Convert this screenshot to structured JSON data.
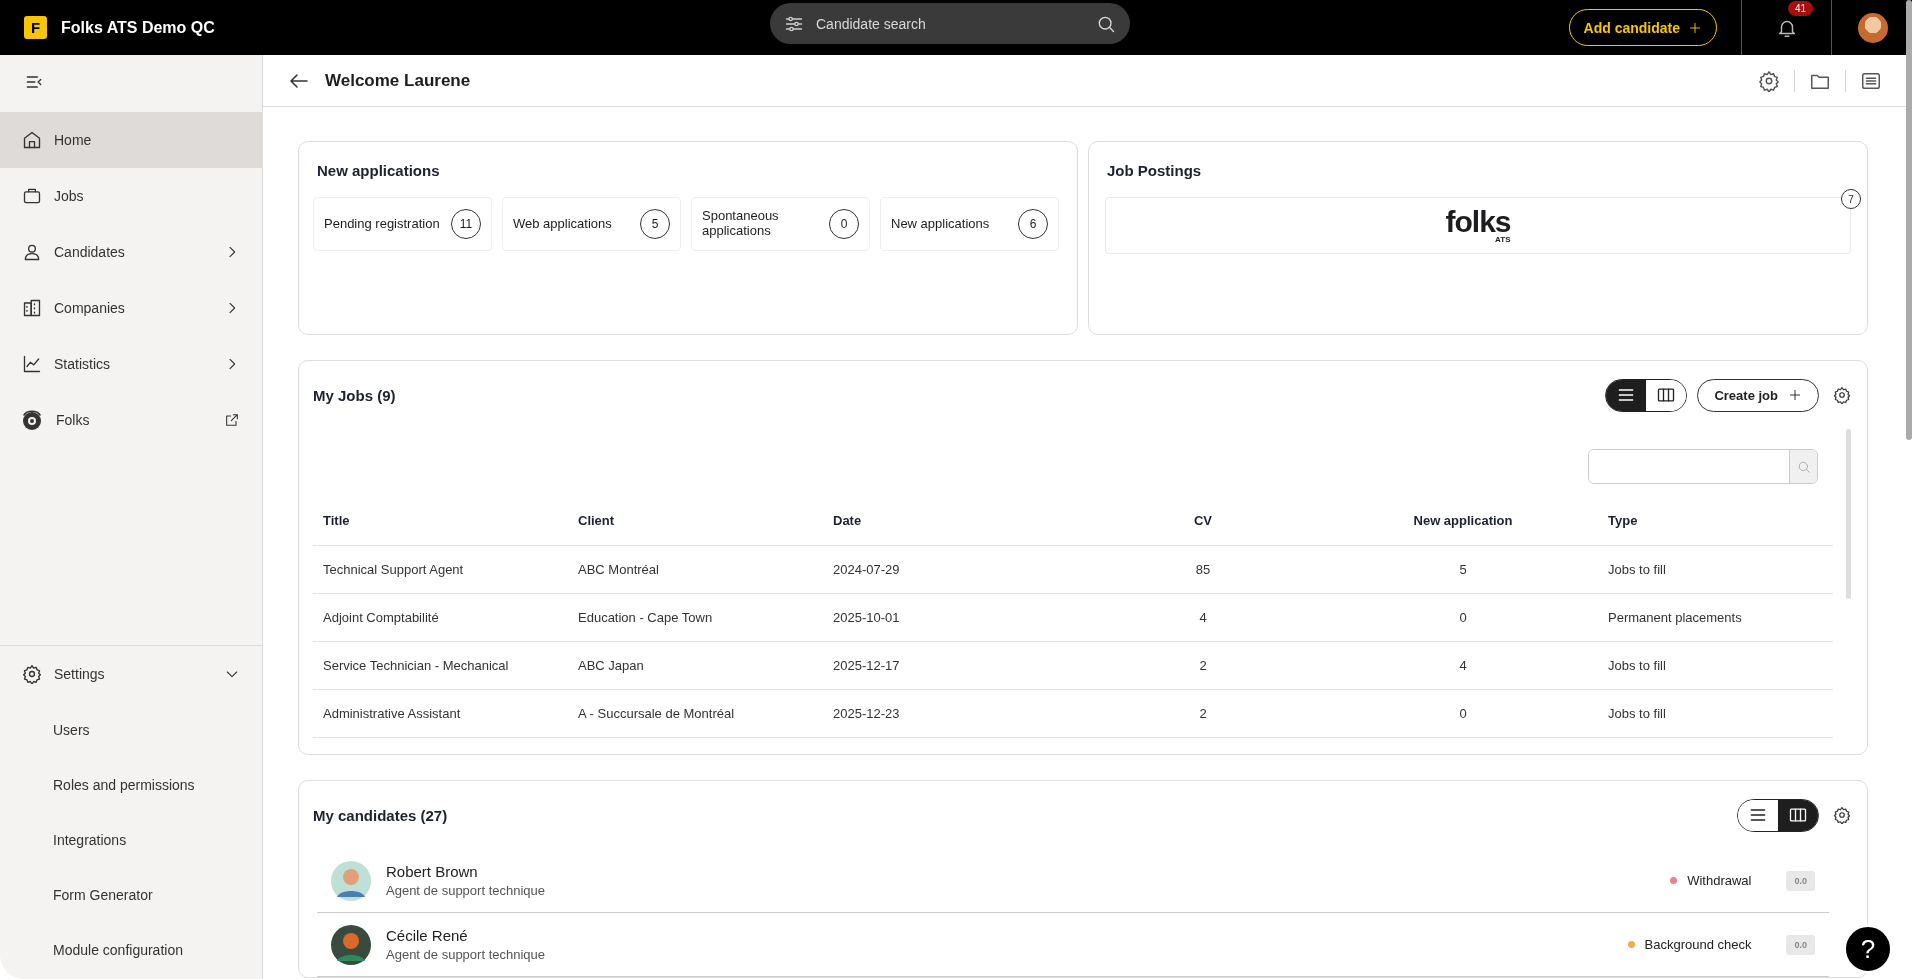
{
  "app": {
    "logo_letter": "F",
    "title": "Folks ATS Demo QC"
  },
  "search": {
    "placeholder": "Candidate search"
  },
  "add_button": {
    "label": "Add candidate"
  },
  "notifications": {
    "count": "41"
  },
  "sidebar": {
    "items": [
      {
        "label": "Home",
        "kind": "page",
        "selected": true
      },
      {
        "label": "Jobs",
        "kind": "page",
        "selected": false
      },
      {
        "label": "Candidates",
        "kind": "menu",
        "selected": false
      },
      {
        "label": "Companies",
        "kind": "menu",
        "selected": false
      },
      {
        "label": "Statistics",
        "kind": "menu",
        "selected": false
      },
      {
        "label": "Folks",
        "kind": "external",
        "selected": false
      }
    ],
    "settings": {
      "label": "Settings",
      "expanded": true,
      "children": [
        {
          "label": "Users"
        },
        {
          "label": "Roles and permissions"
        },
        {
          "label": "Integrations"
        },
        {
          "label": "Form Generator"
        },
        {
          "label": "Module configuration"
        }
      ]
    }
  },
  "page": {
    "title": "Welcome Laurene"
  },
  "new_applications": {
    "title": "New applications",
    "tiles": [
      {
        "label": "Pending registration",
        "count": "11"
      },
      {
        "label": "Web applications",
        "count": "5"
      },
      {
        "label": "Spontaneous applications",
        "count": "0"
      },
      {
        "label": "New applications",
        "count": "6"
      }
    ]
  },
  "job_postings": {
    "title": "Job Postings",
    "boards": [
      {
        "logo": "folks",
        "sublogo": "ATS",
        "count": "7"
      }
    ]
  },
  "my_jobs": {
    "title": "My Jobs (9)",
    "views": [
      {
        "kind": "list",
        "selected": true
      },
      {
        "kind": "board",
        "selected": false
      }
    ],
    "create_button": "Create job",
    "table": {
      "columns": [
        "Title",
        "Client",
        "Date",
        "CV",
        "New application",
        "Type"
      ],
      "rows": [
        [
          "Technical Support Agent",
          "ABC Montréal",
          "2024-07-29",
          "85",
          "5",
          "Jobs to fill"
        ],
        [
          "Adjoint Comptabilité",
          "Education - Cape Town",
          "2025-10-01",
          "4",
          "0",
          "Permanent placements"
        ],
        [
          "Service Technician - Mechanical",
          "ABC Japan",
          "2025-12-17",
          "2",
          "4",
          "Jobs to fill"
        ],
        [
          "Administrative Assistant",
          "A - Succursale de Montréal",
          "2025-12-23",
          "2",
          "0",
          "Jobs to fill"
        ]
      ]
    }
  },
  "my_candidates": {
    "title": "My candidates (27)",
    "views": [
      {
        "kind": "list",
        "selected": false
      },
      {
        "kind": "board",
        "selected": true
      }
    ],
    "candidates": [
      {
        "name": "Robert Brown",
        "role": "Agent de support technique",
        "status": "Withdrawal",
        "color": "#e8828f",
        "score": "0.0"
      },
      {
        "name": "Cécile René",
        "role": "Agent de support technique",
        "status": "Background check",
        "color": "#f4a85c",
        "score": "0.0"
      }
    ]
  },
  "help_button": {
    "label": "?"
  }
}
